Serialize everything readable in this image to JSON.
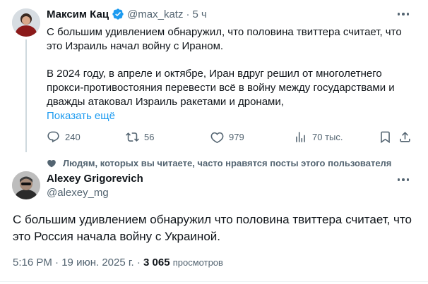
{
  "tweet1": {
    "author_name": "Максим Кац",
    "handle": "@max_katz",
    "separator": "·",
    "time": "5 ч",
    "text_line1": "С большим удивлением обнаружил, что половина твиттера считает, что",
    "text_line2": "это Израиль начал войну с Ираном.",
    "text_line3": "В 2024 году, в апреле и октябре, Иран вдруг решил от многолетнего",
    "text_line4": "прокси-противостояния перевести всё в войну между государствами и",
    "text_line5": "дважды атаковал Израиль ракетами и дронами,",
    "show_more": "Показать ещё",
    "replies": "240",
    "reposts": "56",
    "likes": "979",
    "views": "70 тыс."
  },
  "social_context": "Людям, которых вы читаете, часто нравятся посты этого пользователя",
  "tweet2": {
    "author_name": "Alexey Grigorevich",
    "handle": "@alexey_mg",
    "text_line1": "С большим удивлением обнаружил что половина твиттера считает, что",
    "text_line2": "это Россия начала войну с Украиной.",
    "time": "5:16 PM",
    "dot": "·",
    "date": "19 июн. 2025 г.",
    "views_count": "3 065",
    "views_label": "просмотров"
  },
  "colors": {
    "accent": "#1d9bf0",
    "muted": "#536471",
    "text": "#0f1419"
  },
  "icons": [
    "verified-icon",
    "more-icon",
    "reply-icon",
    "repost-icon",
    "like-icon",
    "views-icon",
    "bookmark-icon",
    "share-icon",
    "heart-icon"
  ]
}
